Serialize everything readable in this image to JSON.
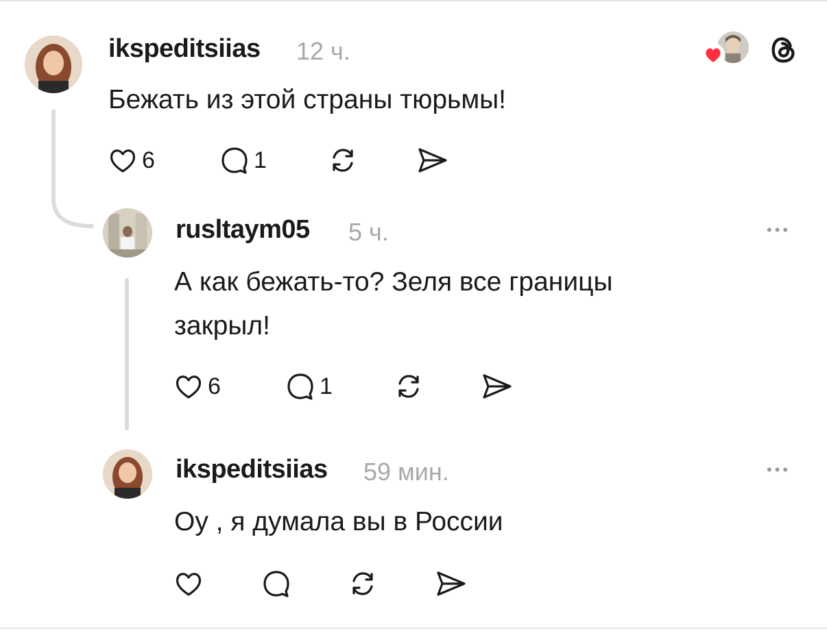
{
  "posts": [
    {
      "username": "ikspeditsiias",
      "time": "12 ч.",
      "text": "Бежать из этой страны тюрьмы!",
      "likes": "6",
      "replies": "1"
    },
    {
      "username": "rusltaym05",
      "time": "5 ч.",
      "text_line1": "А как бежать-то? Зеля все границы",
      "text_line2": "закрыл!",
      "likes": "6",
      "replies": "1",
      "more": "•••"
    },
    {
      "username": "ikspeditsiias",
      "time": "59 мин.",
      "text": "Оу , я  думала вы в России",
      "more": "•••"
    }
  ],
  "icons": {
    "like": "heart-icon",
    "reply": "comment-icon",
    "repost": "repost-icon",
    "share": "send-icon",
    "brand": "threads-logo-icon",
    "liked_badge": "liked-heart-badge-icon"
  },
  "colors": {
    "text": "#1a1a1a",
    "secondary": "#a8a8a8",
    "like_red": "#ff3040",
    "thread_line": "#dcdcdc"
  }
}
